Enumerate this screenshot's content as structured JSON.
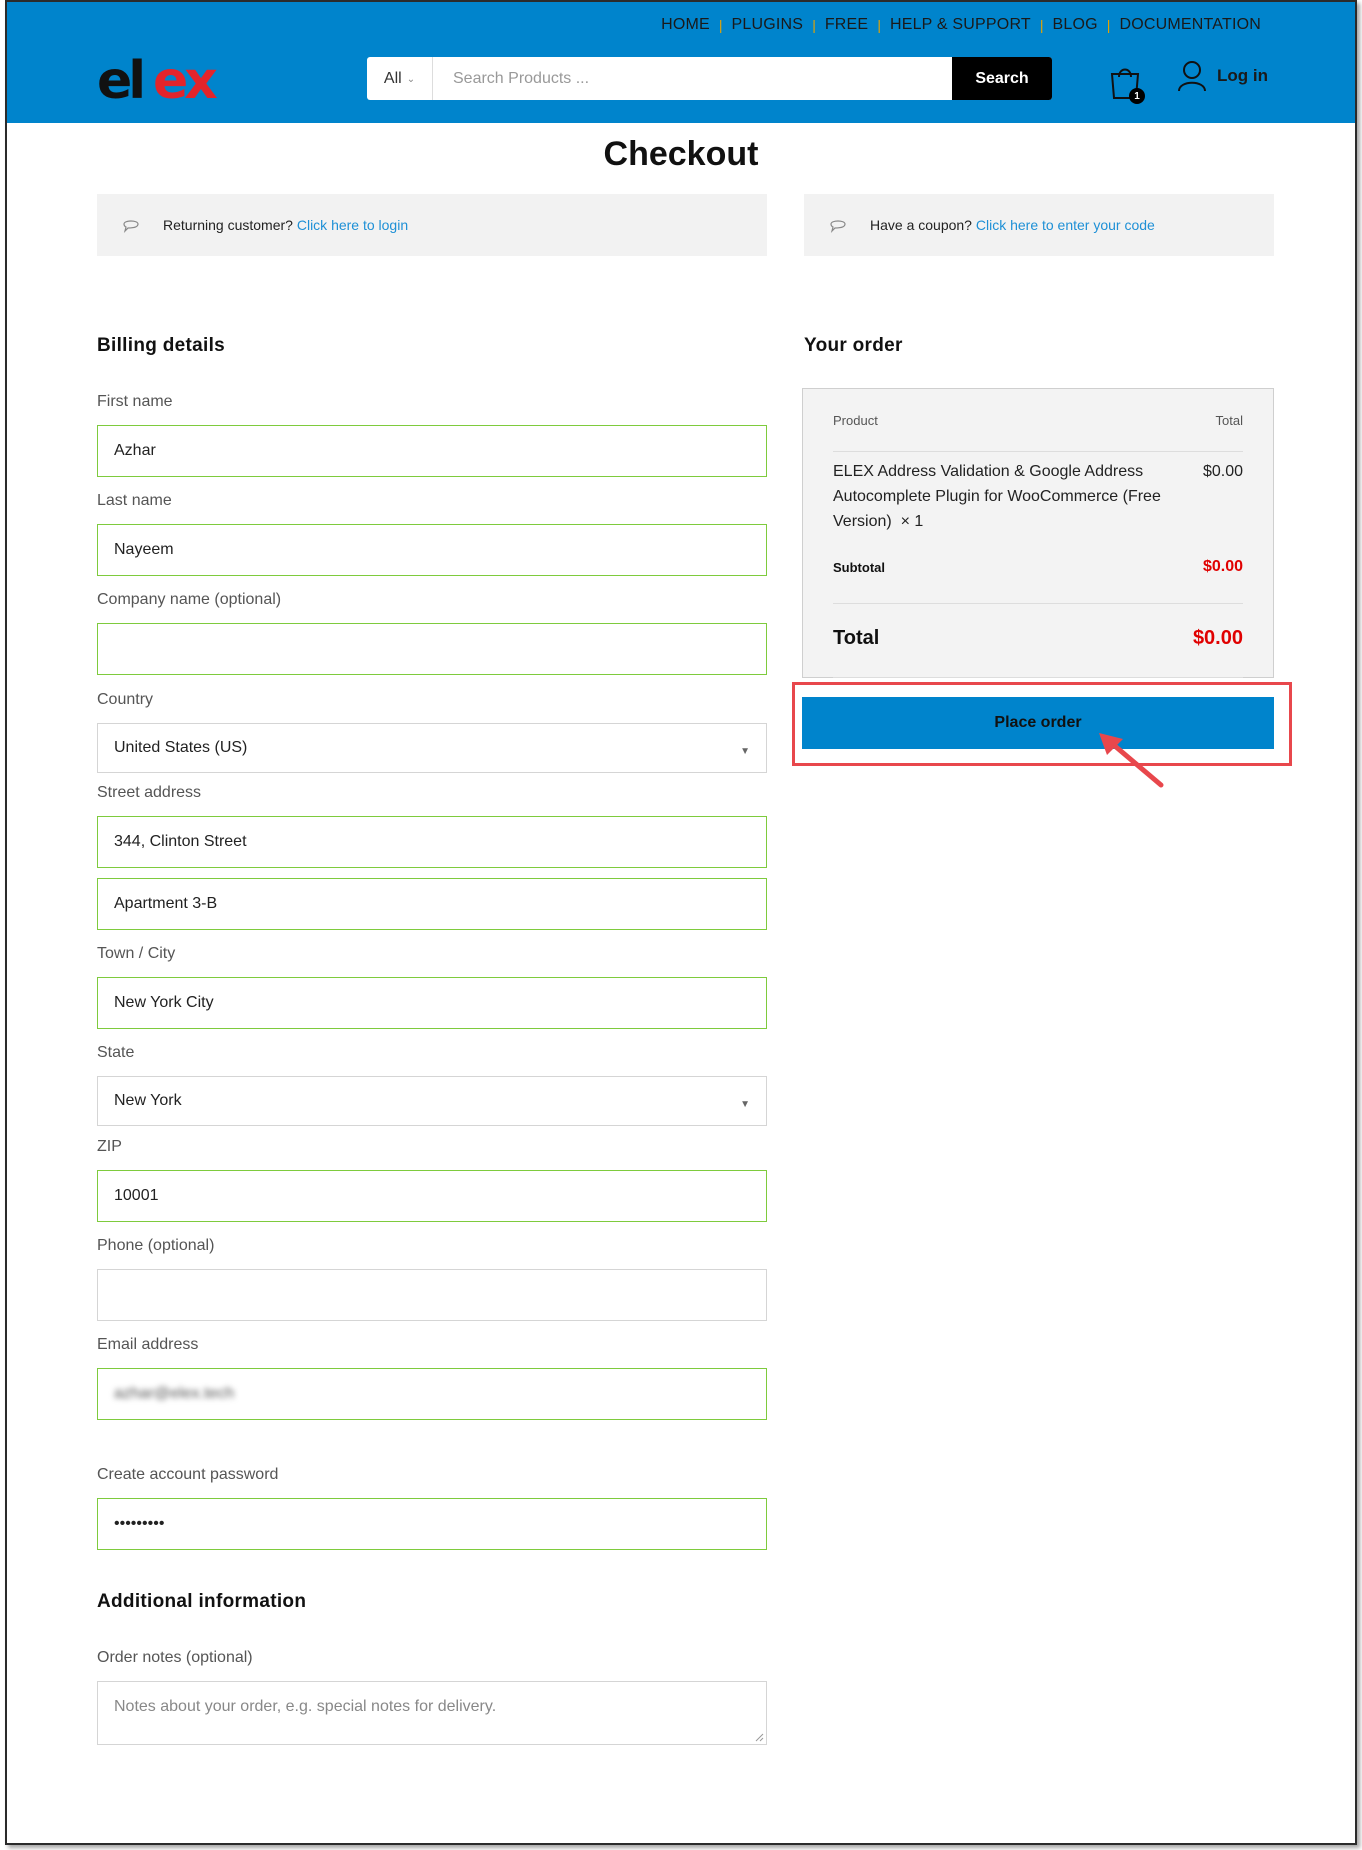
{
  "topnav": {
    "items": [
      "HOME",
      "PLUGINS",
      "FREE",
      "HELP & SUPPORT",
      "BLOG",
      "DOCUMENTATION"
    ]
  },
  "logo": {
    "text": "elex"
  },
  "search": {
    "category": "All",
    "placeholder": "Search Products ...",
    "button_label": "Search"
  },
  "cart": {
    "count": "1"
  },
  "account": {
    "login_label": "Log in"
  },
  "page": {
    "title": "Checkout"
  },
  "notices": {
    "returning": {
      "text": "Returning customer?",
      "link": "Click here to login"
    },
    "coupon": {
      "text": "Have a coupon?",
      "link": "Click here to enter your code"
    }
  },
  "billing": {
    "title": "Billing details",
    "first_name": {
      "label": "First name",
      "value": "Azhar"
    },
    "last_name": {
      "label": "Last name",
      "value": "Nayeem"
    },
    "company": {
      "label": "Company name (optional)",
      "value": ""
    },
    "country": {
      "label": "Country",
      "value": "United States (US)"
    },
    "street": {
      "label": "Street address",
      "value1": "344, Clinton Street",
      "value2": "Apartment 3-B"
    },
    "city": {
      "label": "Town / City",
      "value": "New York City"
    },
    "state": {
      "label": "State",
      "value": "New York"
    },
    "zip": {
      "label": "ZIP",
      "value": "10001"
    },
    "phone": {
      "label": "Phone (optional)",
      "value": ""
    },
    "email": {
      "label": "Email address",
      "value": "azhar@elex.tech"
    },
    "password": {
      "label": "Create account password",
      "value": "•••••••••"
    }
  },
  "additional": {
    "title": "Additional information",
    "notes_label": "Order notes (optional)",
    "notes_placeholder": "Notes about your order, e.g. special notes for delivery."
  },
  "order": {
    "title": "Your order",
    "col_product": "Product",
    "col_total": "Total",
    "item_name": "ELEX Address Validation & Google Address Autocomplete Plugin for WooCommerce (Free Version)",
    "item_qty": "× 1",
    "item_price": "$0.00",
    "subtotal_label": "Subtotal",
    "subtotal": "$0.00",
    "total_label": "Total",
    "total": "$0.00",
    "place_order": "Place order"
  },
  "colors": {
    "brand": "#0084cc",
    "valid_border": "#7ecb3d",
    "price_red": "#e00000",
    "highlight": "#e8474c"
  }
}
